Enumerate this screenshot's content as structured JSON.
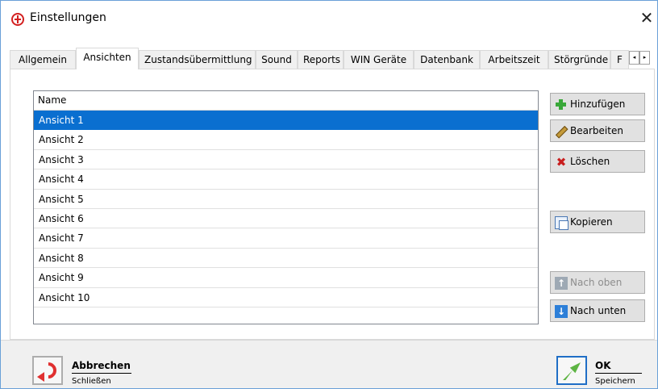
{
  "window": {
    "title": "Einstellungen",
    "close_glyph": "✕"
  },
  "tabs": [
    {
      "label": "Allgemein"
    },
    {
      "label": "Ansichten",
      "active": true
    },
    {
      "label": "Zustandsübermittlung"
    },
    {
      "label": "Sound"
    },
    {
      "label": "Reports"
    },
    {
      "label": "WIN Geräte"
    },
    {
      "label": "Datenbank"
    },
    {
      "label": "Arbeitszeit"
    },
    {
      "label": "Störgründe"
    },
    {
      "label": "F"
    }
  ],
  "tab_scroll": {
    "left_glyph": "◂",
    "right_glyph": "▸"
  },
  "list": {
    "header": "Name",
    "selected_index": 0,
    "items": [
      "Ansicht 1",
      "Ansicht 2",
      "Ansicht 3",
      "Ansicht 4",
      "Ansicht 5",
      "Ansicht 6",
      "Ansicht 7",
      "Ansicht 8",
      "Ansicht 9",
      "Ansicht 10"
    ]
  },
  "side_buttons": {
    "add": {
      "label": "Hinzufügen",
      "icon": "plus-icon"
    },
    "edit": {
      "label": "Bearbeiten",
      "icon": "pencil-icon"
    },
    "delete": {
      "label": "Löschen",
      "icon": "delete-x-icon",
      "glyph": "✖"
    },
    "copy": {
      "label": "Kopieren",
      "icon": "copy-icon"
    },
    "up": {
      "label": "Nach oben",
      "icon": "arrow-up-icon",
      "glyph": "↑",
      "enabled": false
    },
    "down": {
      "label": "Nach unten",
      "icon": "arrow-down-icon",
      "glyph": "↓",
      "enabled": true
    }
  },
  "footer": {
    "cancel": {
      "title": "Abbrechen",
      "subtitle": "Schließen"
    },
    "ok": {
      "title": "OK",
      "subtitle": "Speichern"
    }
  },
  "colors": {
    "selection": "#0a6fd0",
    "accent_border": "#1f6ec6",
    "cancel_red": "#e03030",
    "ok_green": "#5db443"
  }
}
